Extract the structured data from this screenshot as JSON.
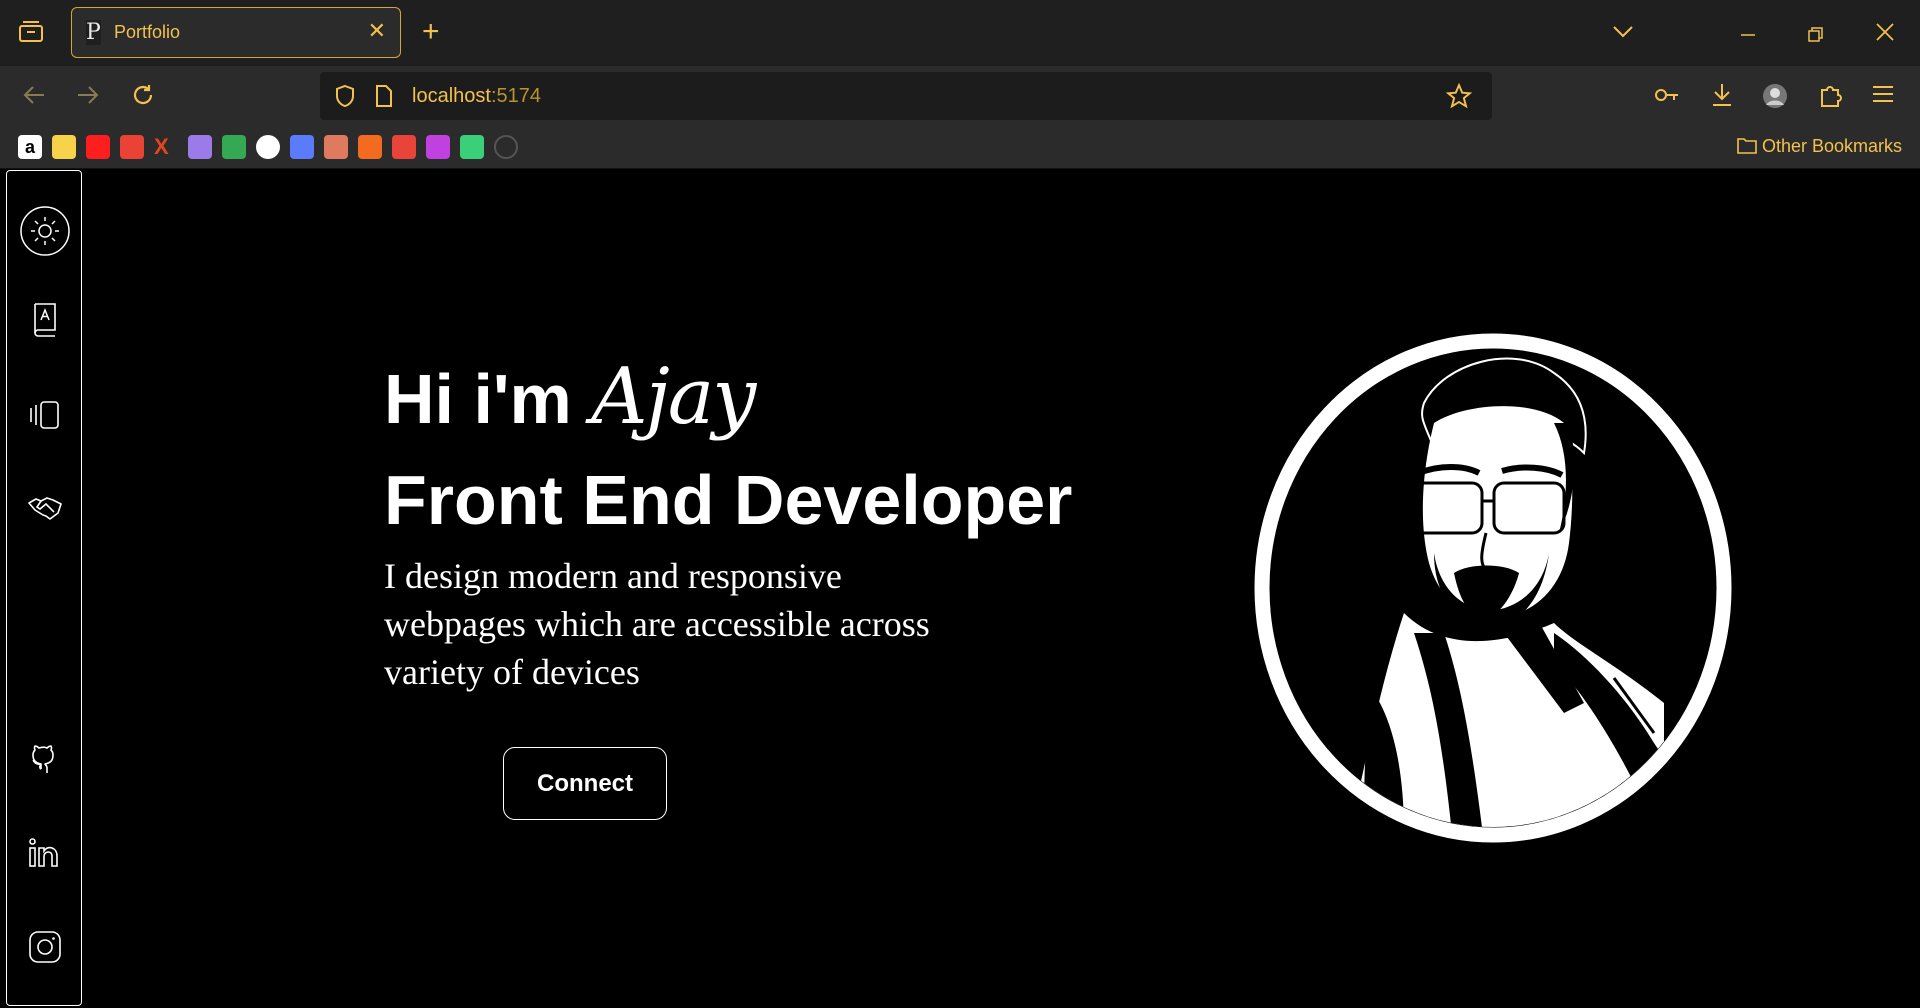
{
  "browser": {
    "tab": {
      "favicon_letter": "P",
      "title": "Portfolio"
    },
    "address": {
      "host": "localhost",
      "port": ":5174"
    },
    "other_bookmarks_label": "Other Bookmarks",
    "bookmarks": [
      {
        "icon": "amazon-icon",
        "color": "#ffffff"
      },
      {
        "icon": "flipkart-icon",
        "color": "#f7d34a"
      },
      {
        "icon": "youtube-icon",
        "color": "#ff1e1e"
      },
      {
        "icon": "gmail-icon",
        "color": "#ea4335"
      },
      {
        "icon": "x-icon",
        "color": "#e2451f"
      },
      {
        "icon": "orb-icon",
        "color": "#9b7be8"
      },
      {
        "icon": "google-drive-icon",
        "color": "#34a853"
      },
      {
        "icon": "chatgpt-icon",
        "color": "#ffffff"
      },
      {
        "icon": "bird-icon",
        "color": "#5b7cfa"
      },
      {
        "icon": "claude-icon",
        "color": "#e07a5f"
      },
      {
        "icon": "app-orange-icon",
        "color": "#f26b21"
      },
      {
        "icon": "play-red-icon",
        "color": "#e8443a"
      },
      {
        "icon": "infinity-icon",
        "color": "#c040e0"
      },
      {
        "icon": "blocks-icon",
        "color": "#3ad07a"
      },
      {
        "icon": "github-bookmark-icon",
        "color": "#555555"
      }
    ]
  },
  "hero": {
    "greeting": "Hi i'm",
    "name": "Ajay",
    "role": "Front End Developer",
    "description": "I design modern and responsive webpages which are accessible across variety of devices",
    "cta_label": "Connect"
  },
  "sidebar": {
    "icons": [
      "theme-sun-icon",
      "about-book-icon",
      "projects-cards-icon",
      "contact-handshake-icon",
      "github-icon",
      "linkedin-icon",
      "instagram-icon"
    ]
  },
  "colors": {
    "accent": "#f2c14e",
    "page_bg": "#000000",
    "chrome_bg": "#1f1f1f"
  }
}
